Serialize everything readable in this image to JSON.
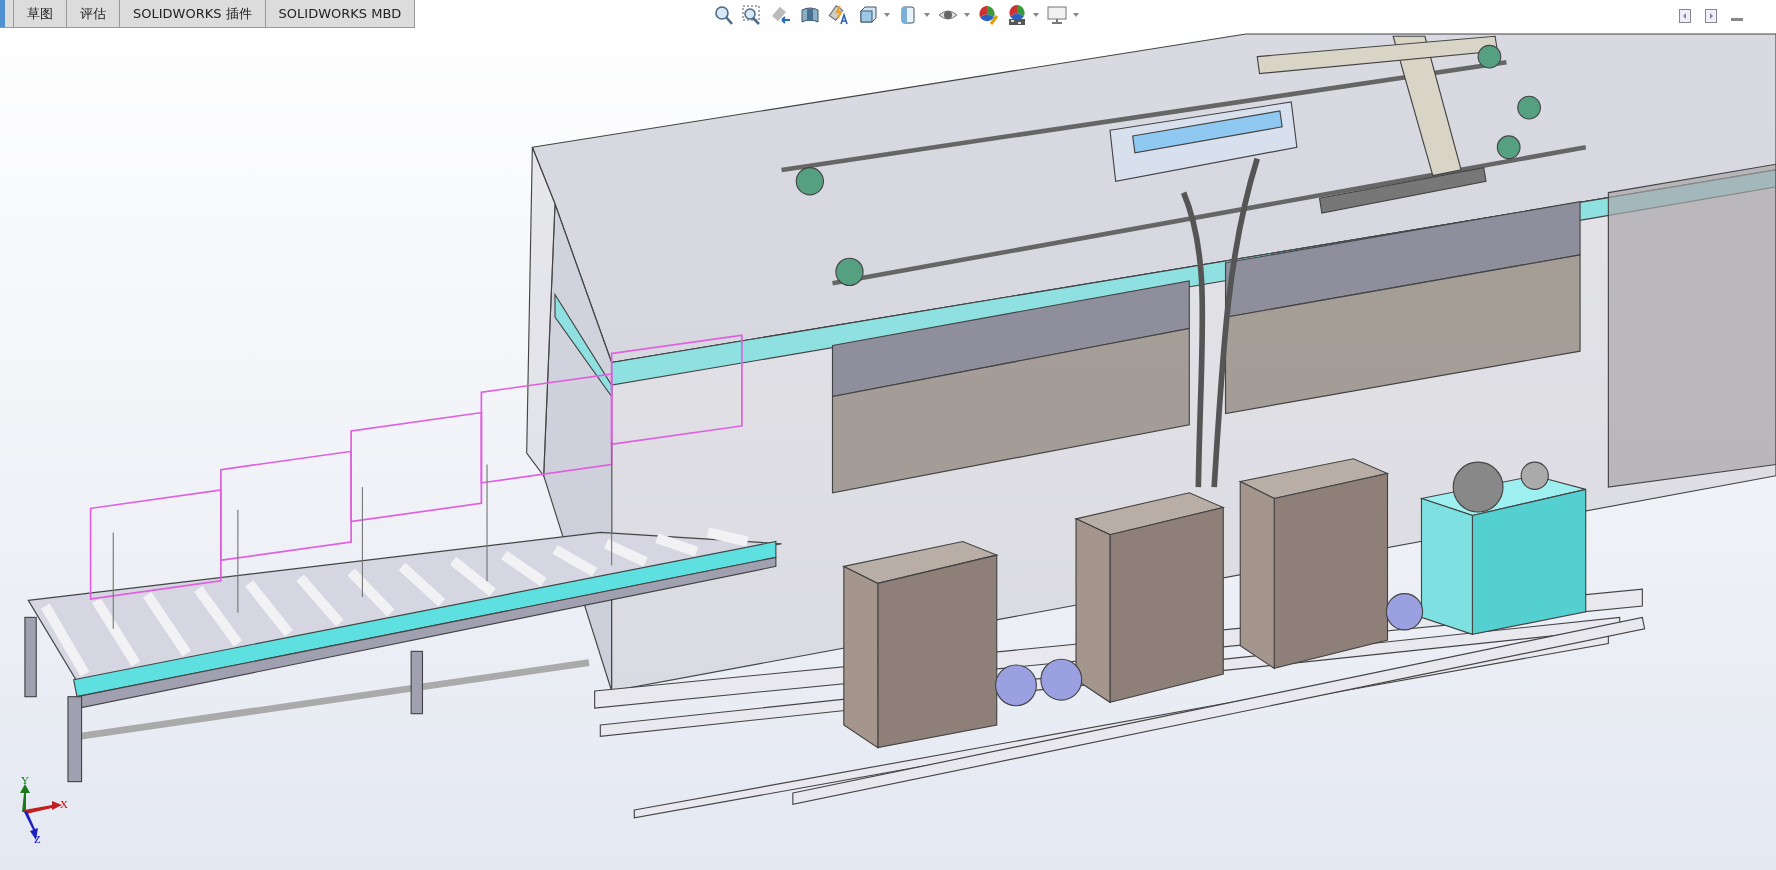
{
  "tabs": [
    {
      "label": "草图"
    },
    {
      "label": "评估"
    },
    {
      "label": "SOLIDWORKS 插件"
    },
    {
      "label": "SOLIDWORKS MBD"
    }
  ],
  "triad": {
    "axes": [
      {
        "label": "X",
        "kind": "x"
      },
      {
        "label": "Y",
        "kind": "y"
      },
      {
        "label": "Z",
        "kind": "z"
      }
    ]
  }
}
